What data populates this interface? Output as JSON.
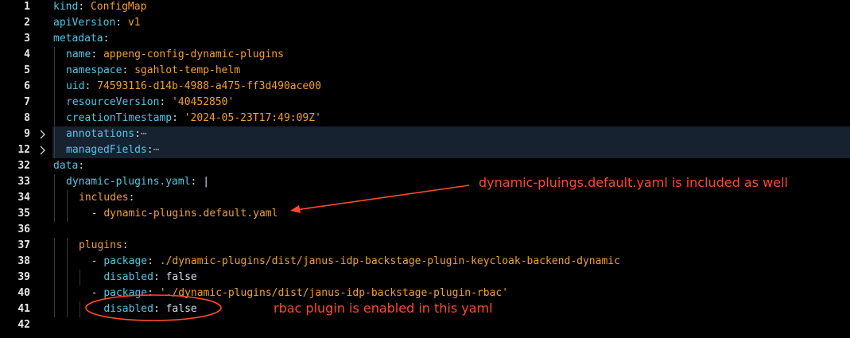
{
  "editor": {
    "lines": [
      {
        "n": "1",
        "indent": 0,
        "tokens": [
          {
            "t": "kind",
            "c": "k"
          },
          {
            "t": ": ",
            "c": "p"
          },
          {
            "t": "ConfigMap",
            "c": "s"
          }
        ]
      },
      {
        "n": "2",
        "indent": 0,
        "tokens": [
          {
            "t": "apiVersion",
            "c": "k"
          },
          {
            "t": ": ",
            "c": "p"
          },
          {
            "t": "v1",
            "c": "s"
          }
        ]
      },
      {
        "n": "3",
        "indent": 0,
        "tokens": [
          {
            "t": "metadata",
            "c": "k"
          },
          {
            "t": ":",
            "c": "p"
          }
        ]
      },
      {
        "n": "4",
        "indent": 1,
        "tokens": [
          {
            "t": "name",
            "c": "k"
          },
          {
            "t": ": ",
            "c": "p"
          },
          {
            "t": "appeng-config-dynamic-plugins",
            "c": "s"
          }
        ]
      },
      {
        "n": "5",
        "indent": 1,
        "tokens": [
          {
            "t": "namespace",
            "c": "k"
          },
          {
            "t": ": ",
            "c": "p"
          },
          {
            "t": "sgahlot-temp-helm",
            "c": "s"
          }
        ]
      },
      {
        "n": "6",
        "indent": 1,
        "tokens": [
          {
            "t": "uid",
            "c": "k"
          },
          {
            "t": ": ",
            "c": "p"
          },
          {
            "t": "74593116-d14b-4988-a475-ff3d490ace00",
            "c": "s"
          }
        ]
      },
      {
        "n": "7",
        "indent": 1,
        "tokens": [
          {
            "t": "resourceVersion",
            "c": "k"
          },
          {
            "t": ": ",
            "c": "p"
          },
          {
            "t": "'40452850'",
            "c": "s"
          }
        ]
      },
      {
        "n": "8",
        "indent": 1,
        "tokens": [
          {
            "t": "creationTimestamp",
            "c": "k"
          },
          {
            "t": ": ",
            "c": "p"
          },
          {
            "t": "'2024-05-23T17:49:09Z'",
            "c": "s"
          }
        ]
      },
      {
        "n": "9",
        "indent": 1,
        "folded": true,
        "tokens": [
          {
            "t": "annotations",
            "c": "k"
          },
          {
            "t": ":",
            "c": "p"
          },
          {
            "t": "⋯",
            "c": "dots"
          }
        ]
      },
      {
        "n": "12",
        "indent": 1,
        "folded": true,
        "tokens": [
          {
            "t": "managedFields",
            "c": "k"
          },
          {
            "t": ":",
            "c": "p"
          },
          {
            "t": "⋯",
            "c": "dots"
          }
        ]
      },
      {
        "n": "32",
        "indent": 0,
        "tokens": [
          {
            "t": "data",
            "c": "k"
          },
          {
            "t": ":",
            "c": "p"
          }
        ]
      },
      {
        "n": "33",
        "indent": 1,
        "tokens": [
          {
            "t": "dynamic-plugins.yaml",
            "c": "k"
          },
          {
            "t": ": ",
            "c": "p"
          },
          {
            "t": "|",
            "c": "b"
          }
        ]
      },
      {
        "n": "34",
        "indent": 2,
        "tokens": [
          {
            "t": "includes",
            "c": "s"
          },
          {
            "t": ":",
            "c": "p"
          }
        ]
      },
      {
        "n": "35",
        "indent": 2,
        "guides": [
          2
        ],
        "tokens": [
          {
            "t": "  - ",
            "c": "p"
          },
          {
            "t": "dynamic-plugins.default.yaml",
            "c": "s"
          }
        ]
      },
      {
        "n": "36",
        "indent": 0,
        "tokens": []
      },
      {
        "n": "37",
        "indent": 2,
        "tokens": [
          {
            "t": "plugins",
            "c": "s"
          },
          {
            "t": ":",
            "c": "p"
          }
        ]
      },
      {
        "n": "38",
        "indent": 2,
        "guides": [
          2
        ],
        "tokens": [
          {
            "t": "  - ",
            "c": "p"
          },
          {
            "t": "package",
            "c": "k"
          },
          {
            "t": ": ",
            "c": "p"
          },
          {
            "t": "./dynamic-plugins/dist/janus-idp-backstage-plugin-keycloak-backend-dynamic",
            "c": "s"
          }
        ]
      },
      {
        "n": "39",
        "indent": 2,
        "guides": [
          2,
          3
        ],
        "tokens": [
          {
            "t": "    ",
            "c": "p"
          },
          {
            "t": "disabled",
            "c": "k"
          },
          {
            "t": ": ",
            "c": "p"
          },
          {
            "t": "false",
            "c": "b"
          }
        ]
      },
      {
        "n": "40",
        "indent": 2,
        "guides": [
          2
        ],
        "tokens": [
          {
            "t": "  - ",
            "c": "p"
          },
          {
            "t": "package",
            "c": "k"
          },
          {
            "t": ": ",
            "c": "p"
          },
          {
            "t": "'./dynamic-plugins/dist/janus-idp-backstage-plugin-rbac'",
            "c": "s"
          }
        ]
      },
      {
        "n": "41",
        "indent": 2,
        "guides": [
          2,
          3
        ],
        "tokens": [
          {
            "t": "    ",
            "c": "p"
          },
          {
            "t": "disabled",
            "c": "k"
          },
          {
            "t": ": ",
            "c": "p"
          },
          {
            "t": "false",
            "c": "b"
          }
        ]
      },
      {
        "n": "42",
        "indent": 0,
        "tokens": []
      }
    ]
  },
  "annotations": {
    "includes_note": "dynamic-pluings.default.yaml is included as well",
    "rbac_note": "rbac plugin is enabled in this yaml",
    "color": "#ff4a28"
  },
  "colors": {
    "key": "#4ec9e6",
    "string": "#f0a030",
    "highlight_bg": "#172230"
  }
}
